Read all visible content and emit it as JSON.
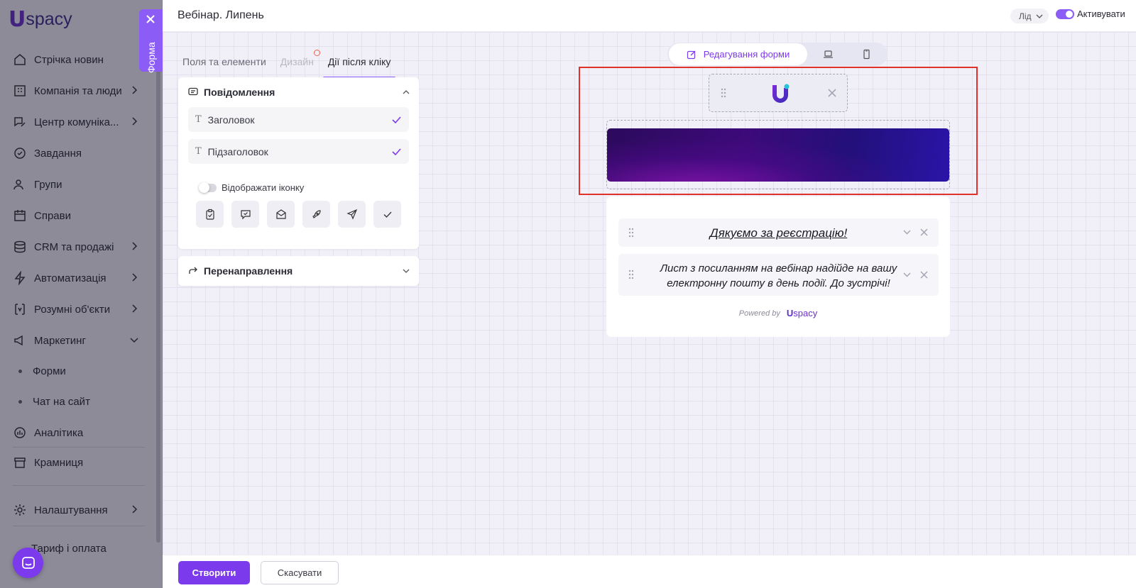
{
  "sidebar": {
    "logo_mark": "U",
    "logo_text": "spacy",
    "items": [
      {
        "label": "Стрічка новин",
        "icon": "home-icon"
      },
      {
        "label": "Компанія та люди",
        "icon": "building-icon"
      },
      {
        "label": "Центр комуніка...",
        "icon": "chat-edit-icon"
      },
      {
        "label": "Завдання",
        "icon": "check-circle-icon"
      },
      {
        "label": "Групи",
        "icon": "users-icon"
      },
      {
        "label": "Справи",
        "icon": "calendar-icon"
      },
      {
        "label": "CRM та продажі",
        "icon": "database-icon"
      },
      {
        "label": "Автоматизація",
        "icon": "lightning-icon"
      },
      {
        "label": "Розумні об'єкти",
        "icon": "smart-object-icon"
      },
      {
        "label": "Маркетинг",
        "icon": "megaphone-icon"
      }
    ],
    "sub_items": [
      {
        "label": "Форми"
      },
      {
        "label": "Чат на сайт"
      }
    ],
    "bottom_items": [
      {
        "label": "Аналітика",
        "icon": "chart-icon"
      },
      {
        "label": "Крамниця",
        "icon": "store-icon"
      },
      {
        "label": "Налаштування",
        "icon": "gear-icon"
      },
      {
        "label": "Тариф і оплата",
        "icon": "wallet-icon"
      }
    ]
  },
  "form_tab": {
    "label": "Форма"
  },
  "header": {
    "title": "Вебінар. Липень",
    "entity_select": "Лід",
    "activate_label": "Активувати"
  },
  "settings": {
    "tabs": [
      {
        "label": "Поля та елементи"
      },
      {
        "label": "Дизайн"
      },
      {
        "label": "Дії після кліку"
      }
    ],
    "message_section": {
      "title": "Повідомлення",
      "rows": [
        {
          "label": "Заголовок"
        },
        {
          "label": "Підзаголовок"
        }
      ],
      "show_icon_label": "Відображати іконку",
      "icon_options": [
        "clipboard-check-icon",
        "chat-check-icon",
        "mail-open-icon",
        "rocket-icon",
        "send-icon",
        "check-icon"
      ]
    },
    "redirect_section": {
      "title": "Перенаправлення"
    }
  },
  "preview": {
    "mode_label": "Редагування форми",
    "modes": [
      "edit-form",
      "desktop-view",
      "mobile-view"
    ],
    "title_text": "Дякуємо за реєстрацію!",
    "subtitle_text": "Лист з посиланням на вебінар надійде на вашу електронну пошту в день події. До зустрічі!",
    "powered_by": "Powered by",
    "powered_logo": "spacy"
  },
  "footer": {
    "create_label": "Створити",
    "cancel_label": "Скасувати"
  },
  "colors": {
    "accent": "#7c3aed",
    "highlight": "#e0312b"
  }
}
